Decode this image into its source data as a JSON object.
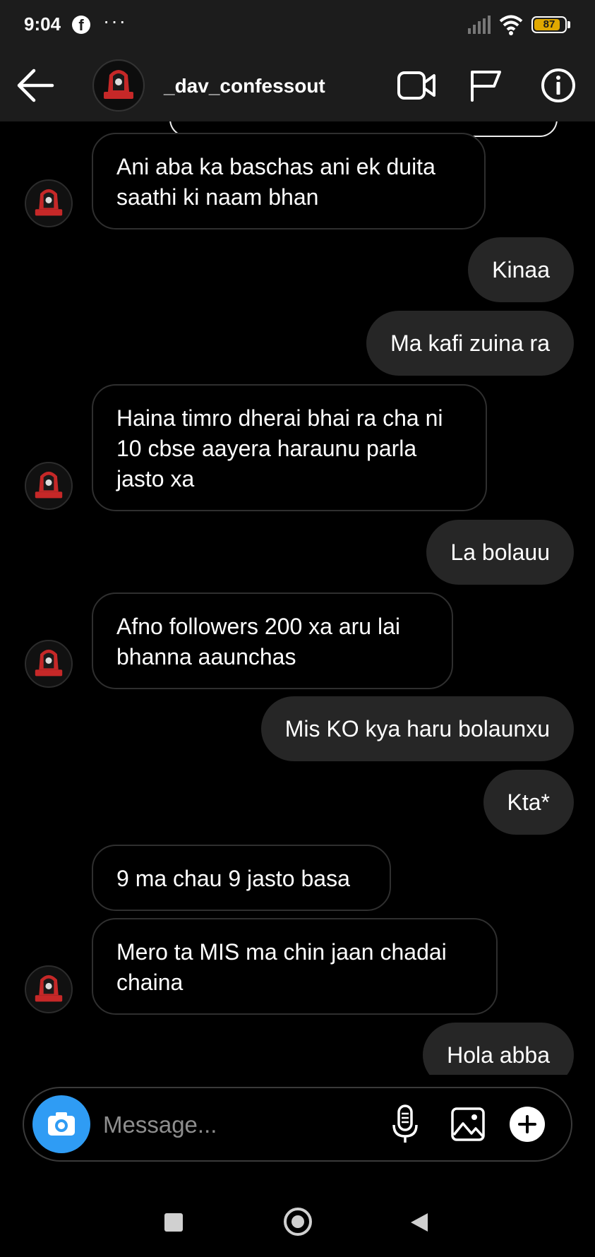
{
  "status_bar": {
    "time": "9:04",
    "facebook_glyph": "f",
    "dots": "···",
    "battery": "87",
    "battery_level_percent": 87,
    "battery_color": "#e0a800"
  },
  "header": {
    "username": "_dav_confessout",
    "icons": [
      "back-arrow-icon",
      "video-call-icon",
      "flag-icon",
      "info-icon"
    ]
  },
  "messages": [
    {
      "side": "in",
      "text": "Ani aba ka baschas ani ek duita saathi ki naam bhan"
    },
    {
      "side": "out",
      "text": "Kinaa"
    },
    {
      "side": "out",
      "text": "Ma kafi zuina ra"
    },
    {
      "side": "in",
      "text": "Haina timro dherai bhai ra cha ni 10 cbse aayera haraunu parla jasto xa"
    },
    {
      "side": "out",
      "text": "La bolauu"
    },
    {
      "side": "in",
      "text": "Afno followers 200 xa aru lai bhanna aaunchas"
    },
    {
      "side": "out",
      "text": "Mis KO kya haru bolaunxu"
    },
    {
      "side": "out",
      "text": "Kta*"
    },
    {
      "side": "in",
      "text": "9 ma chau 9 jasto basa"
    },
    {
      "side": "in",
      "text": "Mero ta MIS ma chin jaan chadai chaina"
    },
    {
      "side": "out",
      "text": "Hola abba"
    }
  ],
  "composer": {
    "placeholder": "Message...",
    "camera_color": "#2f9cf4"
  },
  "nav": {
    "icons": [
      "recents-square-icon",
      "home-circle-icon",
      "back-triangle-icon"
    ]
  }
}
